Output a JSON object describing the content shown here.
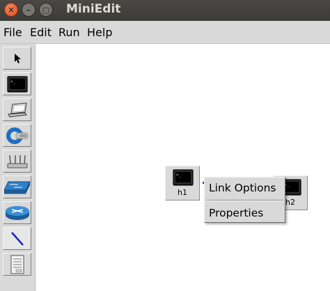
{
  "window": {
    "title": "MiniEdit"
  },
  "menubar": {
    "items": [
      "File",
      "Edit",
      "Run",
      "Help"
    ]
  },
  "toolbar": {
    "tools": [
      {
        "name": "select",
        "icon": "pointer-icon"
      },
      {
        "name": "host",
        "icon": "terminal-icon"
      },
      {
        "name": "laptop",
        "icon": "laptop-icon"
      },
      {
        "name": "controller",
        "icon": "controller-icon"
      },
      {
        "name": "router",
        "icon": "wireless-router-icon"
      },
      {
        "name": "switch",
        "icon": "switch-icon"
      },
      {
        "name": "legacy-router",
        "icon": "router-disc-icon"
      },
      {
        "name": "netlink",
        "icon": "link-line-icon"
      },
      {
        "name": "notes",
        "icon": "document-icon"
      }
    ]
  },
  "canvas": {
    "nodes": [
      {
        "id": "h1",
        "label": "h1",
        "icon": "terminal-icon"
      },
      {
        "id": "h2",
        "label": "h2",
        "icon": "terminal-icon"
      }
    ],
    "link_color": "#1e23c8"
  },
  "context_menu": {
    "items": [
      "Link Options",
      "Properties"
    ]
  }
}
